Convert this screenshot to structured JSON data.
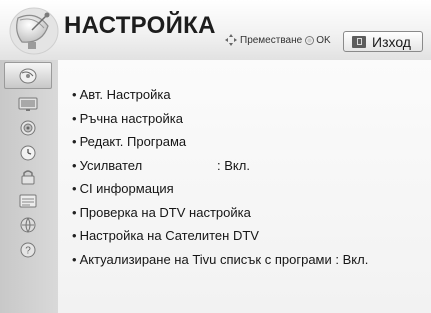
{
  "header": {
    "title": "НАСТРОЙКА",
    "hint_move": "Преместване",
    "hint_ok": "OK",
    "exit_label": "Изход"
  },
  "sidebar": {
    "items": [
      {
        "icon": "setup-dish-icon",
        "active": true
      },
      {
        "icon": "picture-icon",
        "active": false
      },
      {
        "icon": "audio-icon",
        "active": false
      },
      {
        "icon": "time-icon",
        "active": false
      },
      {
        "icon": "lock-icon",
        "active": false
      },
      {
        "icon": "option-icon",
        "active": false
      },
      {
        "icon": "network-icon",
        "active": false
      },
      {
        "icon": "support-icon",
        "active": false
      }
    ]
  },
  "menu": {
    "items": [
      {
        "label": "Авт. Настройка",
        "value": ""
      },
      {
        "label": "Ръчна настройка",
        "value": ""
      },
      {
        "label": "Редакт. Програма",
        "value": ""
      },
      {
        "label": "Усилвател",
        "value": ": Вкл."
      },
      {
        "label": "CI информация",
        "value": ""
      },
      {
        "label": "Проверка на DTV настройка",
        "value": ""
      },
      {
        "label": "Настройка на Сателитен DTV",
        "value": ""
      },
      {
        "label": "Актуализиране на Tivu списък с програми",
        "value": ": Вкл."
      }
    ]
  },
  "colors": {
    "header_bg": "#f2f2f2",
    "sidebar_bg": "#cfcfcf",
    "panel_bg": "#f6f6f6",
    "text": "#161616"
  }
}
